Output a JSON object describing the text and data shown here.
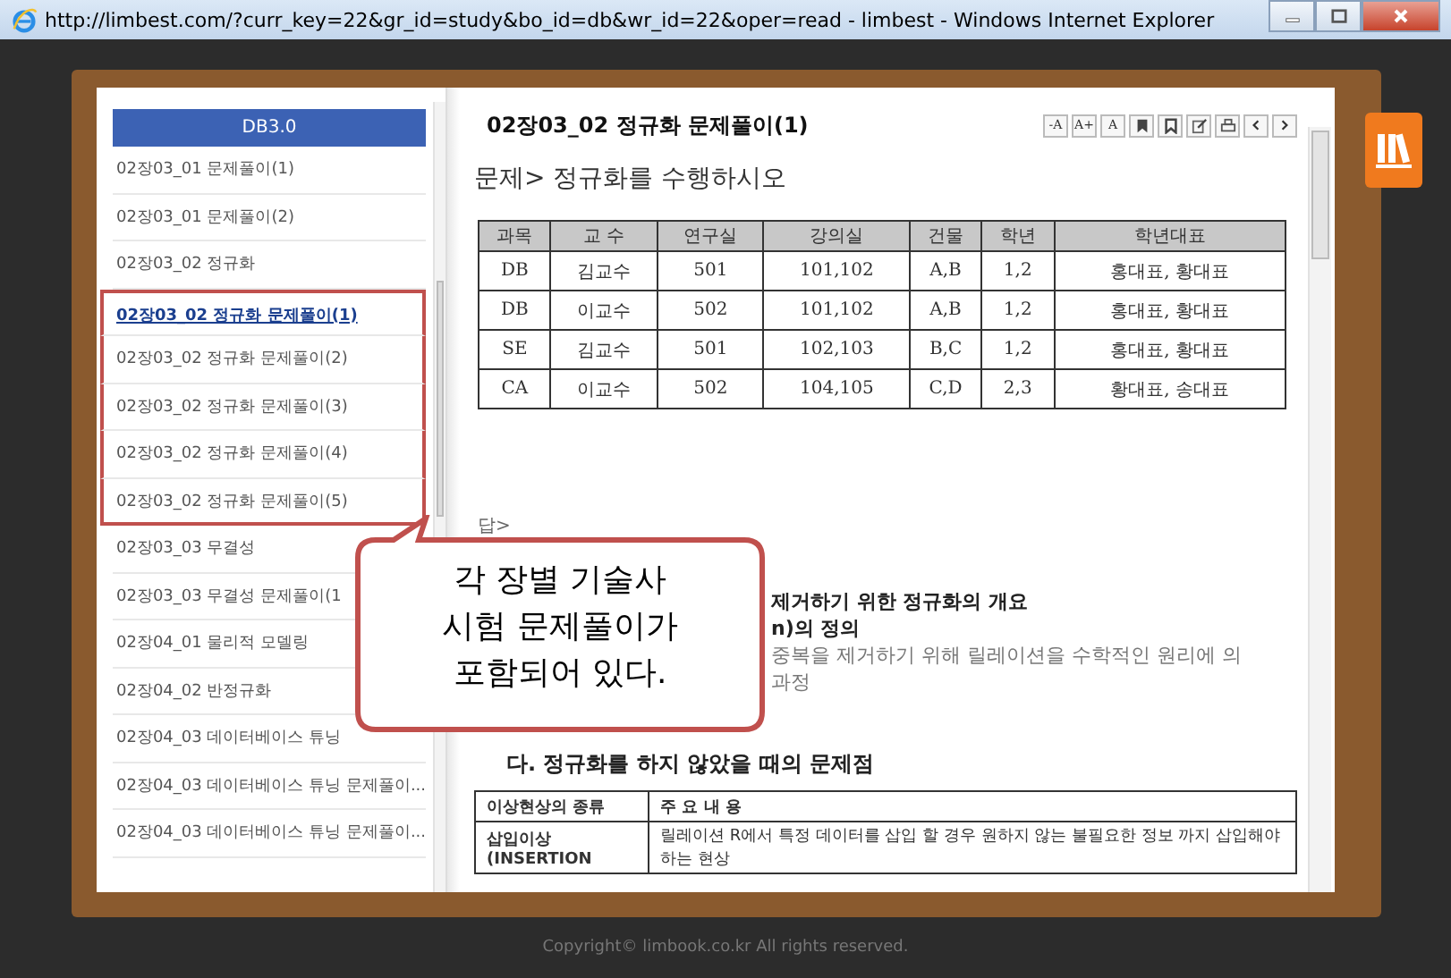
{
  "window": {
    "title": "http://limbest.com/?curr_key=22&gr_id=study&bo_id=db&wr_id=22&oper=read - limbest - Windows Internet Explorer"
  },
  "sidebar": {
    "heading": "DB3.0",
    "items": [
      {
        "label": "02장03_01 문제풀이(1)",
        "selected": false,
        "highlighted": false
      },
      {
        "label": "02장03_01 문제풀이(2)",
        "selected": false,
        "highlighted": false
      },
      {
        "label": "02장03_02 정규화",
        "selected": false,
        "highlighted": false
      },
      {
        "label": "02장03_02 정규화 문제풀이(1)",
        "selected": true,
        "highlighted": true
      },
      {
        "label": "02장03_02 정규화 문제풀이(2)",
        "selected": false,
        "highlighted": true
      },
      {
        "label": "02장03_02 정규화 문제풀이(3)",
        "selected": false,
        "highlighted": true
      },
      {
        "label": "02장03_02 정규화 문제풀이(4)",
        "selected": false,
        "highlighted": true
      },
      {
        "label": "02장03_02 정규화 문제풀이(5)",
        "selected": false,
        "highlighted": true
      },
      {
        "label": "02장03_03 무결성",
        "selected": false,
        "highlighted": false
      },
      {
        "label": "02장03_03 무결성 문제풀이(1",
        "selected": false,
        "highlighted": false
      },
      {
        "label": "02장04_01 물리적 모델링",
        "selected": false,
        "highlighted": false
      },
      {
        "label": "02장04_02 반정규화",
        "selected": false,
        "highlighted": false
      },
      {
        "label": "02장04_03 데이터베이스 튜닝",
        "selected": false,
        "highlighted": false
      },
      {
        "label": "02장04_03 데이터베이스 튜닝 문제풀이...",
        "selected": false,
        "highlighted": false
      },
      {
        "label": "02장04_03 데이터베이스 튜닝 문제풀이...",
        "selected": false,
        "highlighted": false
      }
    ]
  },
  "article": {
    "title": "02장03_02 정규화 문제풀이(1)",
    "toolbar": [
      {
        "kind": "text",
        "label": "-A"
      },
      {
        "kind": "text",
        "label": "A+"
      },
      {
        "kind": "text",
        "label": "A"
      },
      {
        "kind": "bookmark"
      },
      {
        "kind": "bookmark-outline"
      },
      {
        "kind": "edit"
      },
      {
        "kind": "print"
      },
      {
        "kind": "prev"
      },
      {
        "kind": "next"
      }
    ],
    "question": "문제> 정규화를 수행하시오",
    "table": {
      "columns": [
        "과목",
        "교 수",
        "연구실",
        "강의실",
        "건물",
        "학년",
        "학년대표"
      ],
      "rows": [
        [
          "DB",
          "김교수",
          "501",
          "101,102",
          "A,B",
          "1,2",
          "홍대표, 황대표"
        ],
        [
          "DB",
          "이교수",
          "502",
          "101,102",
          "A,B",
          "1,2",
          "홍대표, 황대표"
        ],
        [
          "SE",
          "김교수",
          "501",
          "102,103",
          "B,C",
          "1,2",
          "홍대표, 황대표"
        ],
        [
          "CA",
          "이교수",
          "502",
          "104,105",
          "C,D",
          "2,3",
          "황대표, 송대표"
        ]
      ]
    },
    "answer_label": "답>",
    "lines": [
      {
        "kind": "bold",
        "text": "제거하기 위한 정규화의 개요"
      },
      {
        "kind": "bold",
        "text": "n)의 정의"
      },
      {
        "kind": "plain",
        "text": "중복을 제거하기 위해 릴레이션을 수학적인 원리에 의"
      },
      {
        "kind": "plain",
        "text": "과정"
      }
    ],
    "section": "다. 정규화를 하지 않았을 때의 문제점",
    "anomaly_table": {
      "columns": [
        "이상현상의 종류",
        "주  요  내  용"
      ],
      "rows": [
        [
          "삽입이상\n(INSERTION",
          "릴레이션 R에서 특정 데이터를 삽입 할 경우 원하지 않는 불필요한 정보 까지 삽입해야 하는 현상"
        ]
      ]
    }
  },
  "callout": {
    "text": "각 장별 기술사\n시험 문제풀이가\n포함되어 있다."
  },
  "footer": "Copyright© limbook.co.kr All rights reserved."
}
